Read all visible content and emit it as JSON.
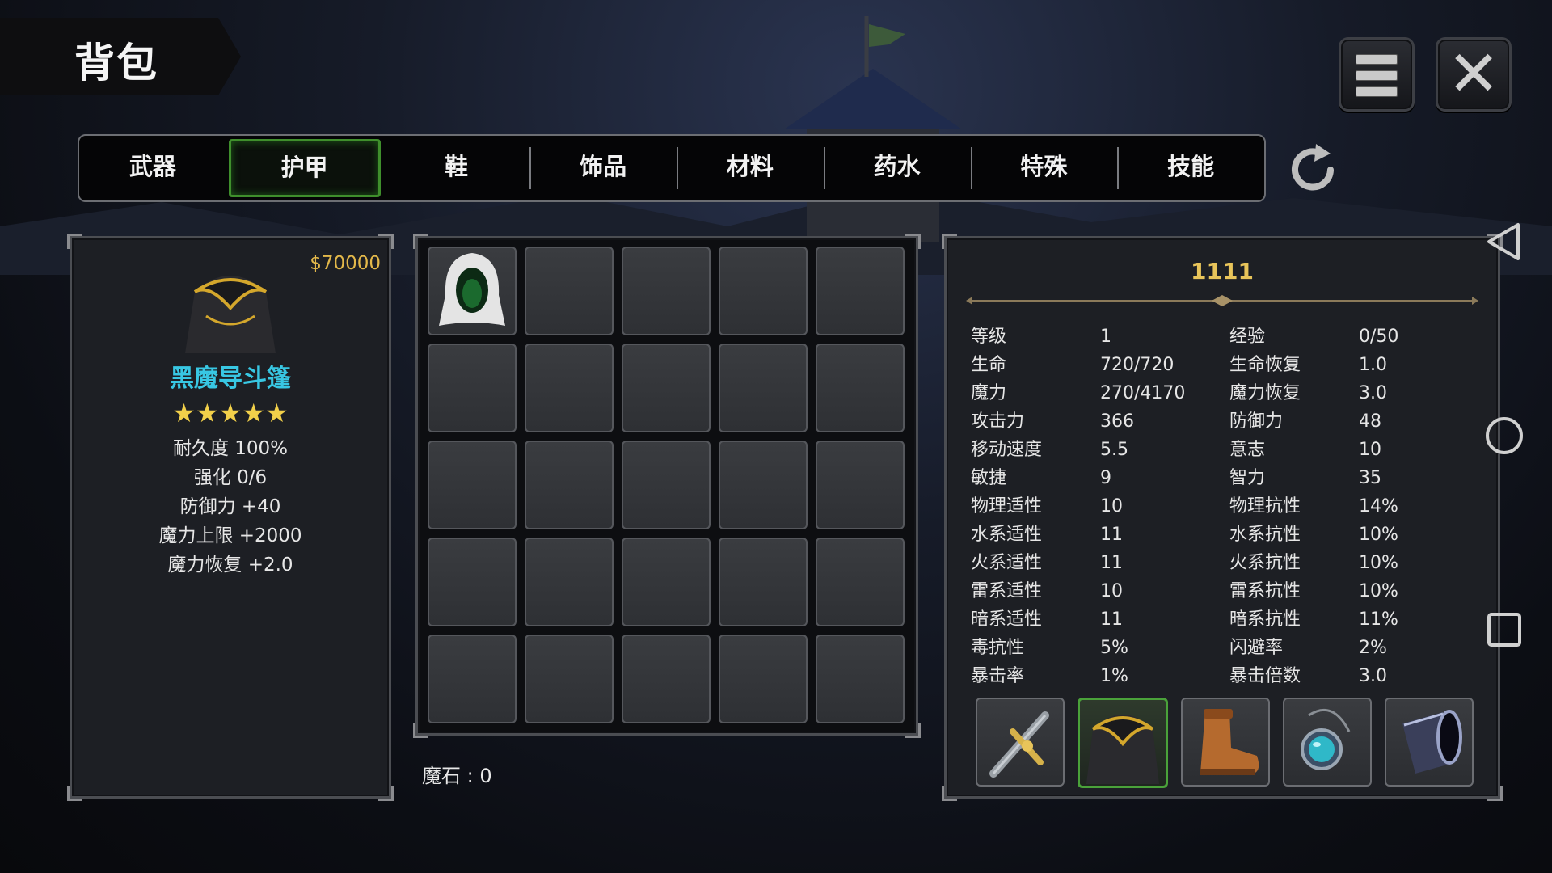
{
  "title": "背包",
  "tabs": [
    {
      "label": "武器",
      "active": false
    },
    {
      "label": "护甲",
      "active": true
    },
    {
      "label": "鞋",
      "active": false
    },
    {
      "label": "饰品",
      "active": false
    },
    {
      "label": "材料",
      "active": false
    },
    {
      "label": "药水",
      "active": false
    },
    {
      "label": "特殊",
      "active": false
    },
    {
      "label": "技能",
      "active": false
    }
  ],
  "item": {
    "price": "$70000",
    "name": "黑魔导斗篷",
    "stars": "★★★★★",
    "lines": [
      "耐久度 100%",
      "强化 0/6",
      "防御力  +40",
      "魔力上限  +2000",
      "魔力恢复  +2.0"
    ],
    "icon": "black-cloak-icon"
  },
  "inventory": {
    "slots_filled": [
      "white-hood-icon"
    ],
    "magic_stone": "魔石 : 0"
  },
  "character": {
    "name": "1111",
    "stats": [
      [
        "等级",
        "1",
        "经验",
        "0/50"
      ],
      [
        "生命",
        "720/720",
        "生命恢复",
        "1.0"
      ],
      [
        "魔力",
        "270/4170",
        "魔力恢复",
        "3.0"
      ],
      [
        "攻击力",
        "366",
        "防御力",
        "48"
      ],
      [
        "移动速度",
        "5.5",
        "意志",
        "10"
      ],
      [
        "敏捷",
        "9",
        "智力",
        "35"
      ],
      [
        "物理适性",
        "10",
        "物理抗性",
        "14%"
      ],
      [
        "水系适性",
        "11",
        "水系抗性",
        "10%"
      ],
      [
        "火系适性",
        "11",
        "火系抗性",
        "10%"
      ],
      [
        "雷系适性",
        "10",
        "雷系抗性",
        "10%"
      ],
      [
        "暗系适性",
        "11",
        "暗系抗性",
        "11%"
      ],
      [
        "毒抗性",
        "5%",
        "闪避率",
        "2%"
      ],
      [
        "暴击率",
        "1%",
        "暴击倍数",
        "3.0"
      ]
    ],
    "equipment": [
      "sword-icon",
      "cloak-icon",
      "boots-icon",
      "amulet-icon",
      "bracer-icon"
    ]
  },
  "colors": {
    "accent_green": "#3f8f2c",
    "gold": "#e8c45a",
    "item_name": "#38c7e3"
  },
  "icons": [
    "menu-icon",
    "close-icon",
    "refresh-icon",
    "nav-back-icon",
    "nav-home-icon",
    "nav-recents-icon"
  ]
}
